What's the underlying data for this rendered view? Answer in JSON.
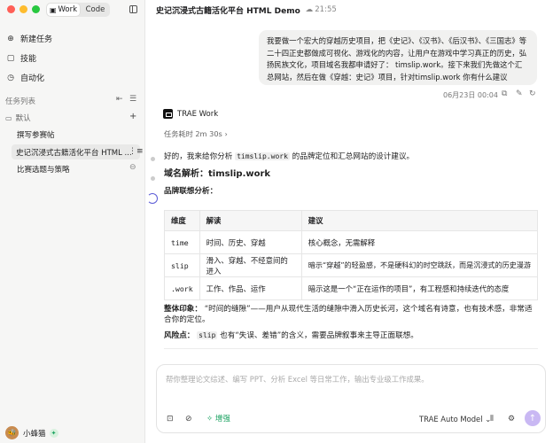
{
  "window": {
    "traffic_lights": [
      "#ff5f57",
      "#febc2e",
      "#28c840"
    ]
  },
  "mode_tabs": [
    "Work",
    "Code"
  ],
  "sidebar": {
    "nav": [
      {
        "icon": "new-task-icon",
        "label": "新建任务"
      },
      {
        "icon": "skills-icon",
        "label": "技能"
      },
      {
        "icon": "automation-icon",
        "label": "自动化"
      }
    ],
    "task_list_title": "任务列表",
    "group_label": "默认",
    "tasks": [
      {
        "label": "撰写参赛帖"
      },
      {
        "label": "史记沉浸式古籍活化平台 HTML ..."
      },
      {
        "label": "比赛选题与策略"
      }
    ],
    "user_name": "小蜂猫"
  },
  "header": {
    "title": "史记沉浸式古籍活化平台 HTML Demo",
    "time": "21:55"
  },
  "user_message": {
    "text": "我要做一个宏大的穿越历史项目，把《史记》、《汉书》、《后汉书》、《三国志》等二十四正史都做成可视化、游戏化的内容，让用户在游戏中学习真正的历史，弘扬民族文化，项目域名我都申请好了： timslip.work。接下来我们先做这个汇总网站，然后在做《穿越：史记》项目，针对timslip.work 你有什么建议",
    "timestamp": "06月23日 00:04"
  },
  "assistant": {
    "name": "TRAE Work",
    "duration": "任务耗时 2m 30s",
    "intro_before": "好的，我来给你分析",
    "intro_code": "timslip.work",
    "intro_after": "的品牌定位和汇总网站的设计建议。",
    "domain_heading": "域名解析：timslip.work",
    "assoc_heading": "品牌联想分析：",
    "table": {
      "headers": [
        "维度",
        "解读",
        "建议"
      ],
      "rows": [
        [
          "time",
          "时间、历史、穿越",
          "核心概念，无需解释"
        ],
        [
          "slip",
          "滑入、穿越、不经意间的进入",
          "暗示“穿越”的轻盈感，不是硬科幻的时空跳跃，而是沉浸式的历史漫游"
        ],
        [
          ".work",
          "工作、作品、运作",
          "暗示这是一个“正在运作的项目”，有工程感和持续迭代的态度"
        ]
      ]
    },
    "overall_label": "整体印象：",
    "overall_text": "“时间的缝隙”——用户从现代生活的缝隙中滑入历史长河，这个域名有诗意，也有技术感，非常适合你的定位。",
    "risk_label": "风险点：",
    "risk_code": "slip",
    "risk_text": "也有“失误、差错”的含义，需要品牌叙事来主导正面联想。"
  },
  "composer": {
    "placeholder": "帮你整理论文综述、编写 PPT、分析 Excel 等日常工作，输出专业级工作成果。",
    "boost_label": "增强",
    "model_label": "TRAE Auto Model"
  }
}
